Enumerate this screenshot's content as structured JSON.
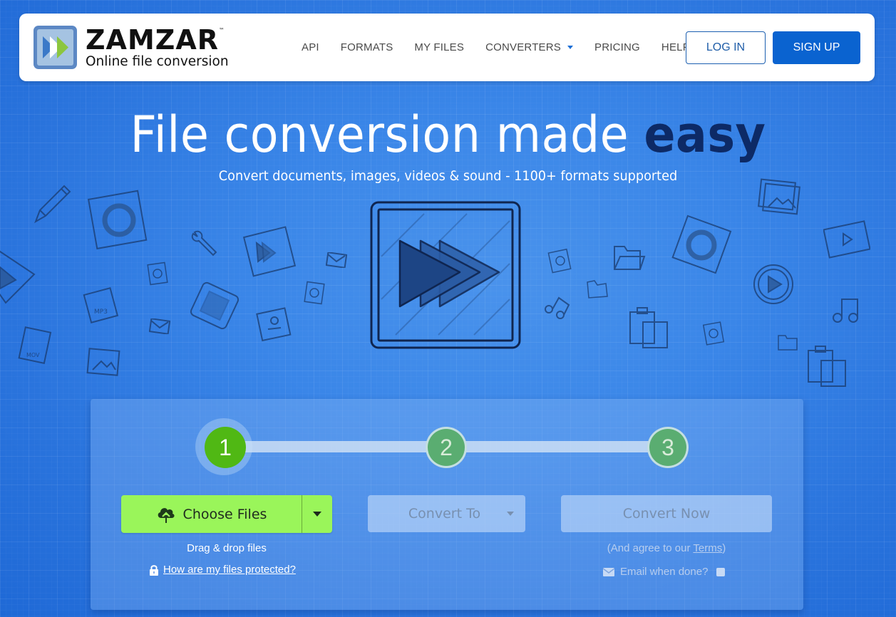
{
  "header": {
    "logo": {
      "name": "ZAMZAR",
      "trademark": "™",
      "tagline": "Online file conversion",
      "icon": "fast-forward-icon"
    },
    "nav": [
      {
        "label": "API"
      },
      {
        "label": "FORMATS"
      },
      {
        "label": "MY FILES"
      },
      {
        "label": "CONVERTERS",
        "has_dropdown": true
      },
      {
        "label": "PRICING"
      },
      {
        "label": "HELP"
      }
    ],
    "login_label": "LOG IN",
    "signup_label": "SIGN UP"
  },
  "hero": {
    "title_main": "File conversion made ",
    "title_emphasis": "easy",
    "subtitle": "Convert documents, images, videos & sound - 1100+ formats supported"
  },
  "converter": {
    "steps": [
      {
        "number": "1",
        "state": "active"
      },
      {
        "number": "2",
        "state": "inactive"
      },
      {
        "number": "3",
        "state": "inactive"
      }
    ],
    "choose_files_label": "Choose Files",
    "choose_files_icon": "cloud-upload-icon",
    "convert_to_label": "Convert To",
    "convert_now_label": "Convert Now",
    "drag_drop_text": "Drag & drop files",
    "protected_link": "How are my files protected?",
    "terms_prefix": "(And agree to our ",
    "terms_link": "Terms",
    "terms_suffix": ")",
    "email_label": "Email when done?",
    "email_checked": false
  },
  "colors": {
    "brand_blue": "#0a63d0",
    "active_step": "#50b814",
    "choose_files_bg": "#9af55a",
    "easy_text": "#0d2a66"
  }
}
